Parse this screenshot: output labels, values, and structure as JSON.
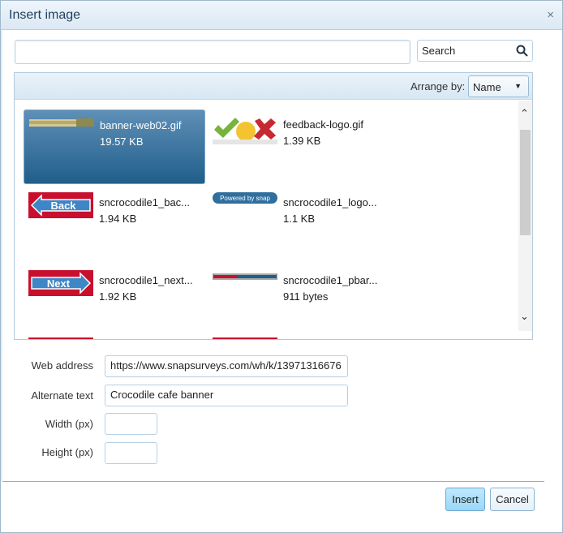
{
  "dialog": {
    "title": "Insert image",
    "close_glyph": "×"
  },
  "search": {
    "input_value": "",
    "button_label": "Search",
    "icon": "search-icon"
  },
  "arrange": {
    "label": "Arrange by:",
    "selected": "Name"
  },
  "files": [
    {
      "name": "banner-web02.gif",
      "size": "19.57 KB",
      "selected": true
    },
    {
      "name": "feedback-logo.gif",
      "size": "1.39 KB",
      "selected": false
    },
    {
      "name": "sncrocodile1_bac...",
      "size": "1.94 KB",
      "selected": false
    },
    {
      "name": "sncrocodile1_logo...",
      "size": "1.1 KB",
      "selected": false
    },
    {
      "name": "sncrocodile1_next...",
      "size": "1.92 KB",
      "selected": false
    },
    {
      "name": "sncrocodile1_pbar...",
      "size": "911 bytes",
      "selected": false
    }
  ],
  "thumbnails": {
    "back_text": "Back",
    "next_text": "Next",
    "powered_by_text": "Powered by snap"
  },
  "form": {
    "web_address_label": "Web address",
    "web_address_value": "https://www.snapsurveys.com/wh/k/13971316676",
    "alternate_text_label": "Alternate text",
    "alternate_text_value": "Crocodile cafe banner",
    "width_label": "Width (px)",
    "width_value": "",
    "height_label": "Height (px)",
    "height_value": ""
  },
  "buttons": {
    "insert": "Insert",
    "cancel": "Cancel"
  },
  "colors": {
    "selected_tile": "#1f5f8a",
    "insert_button": "#9ad7f7",
    "banner_red": "#c8102e"
  }
}
